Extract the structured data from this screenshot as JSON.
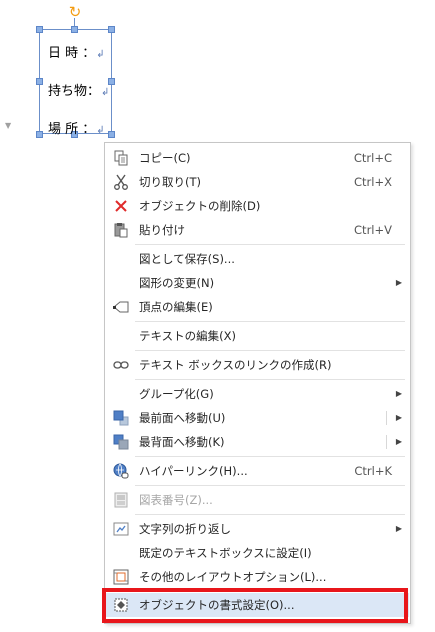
{
  "textbox": {
    "lines": [
      "日 時 ：",
      "持ち物：",
      "場 所 ："
    ],
    "para_mark": "↲"
  },
  "menu": {
    "items": [
      {
        "icon": "copy-icon",
        "label": "コピー(C)",
        "shortcut": "Ctrl+C"
      },
      {
        "icon": "scissors-icon",
        "label": "切り取り(T)",
        "shortcut": "Ctrl+X"
      },
      {
        "icon": "delete-x-icon",
        "label": "オブジェクトの削除(D)",
        "shortcut": ""
      },
      {
        "icon": "paste-icon",
        "label": "貼り付け",
        "shortcut": "Ctrl+V"
      },
      {
        "icon": "",
        "label": "図として保存(S)...",
        "shortcut": ""
      },
      {
        "icon": "",
        "label": "図形の変更(N)",
        "shortcut": "",
        "submenu": true
      },
      {
        "icon": "edit-points-icon",
        "label": "頂点の編集(E)",
        "shortcut": ""
      },
      {
        "icon": "",
        "label": "テキストの編集(X)",
        "shortcut": ""
      },
      {
        "icon": "link-icon",
        "label": "テキスト ボックスのリンクの作成(R)",
        "shortcut": ""
      },
      {
        "icon": "",
        "label": "グループ化(G)",
        "shortcut": "",
        "submenu": true
      },
      {
        "icon": "bring-front-icon",
        "label": "最前面へ移動(U)",
        "shortcut": "",
        "submenu": true,
        "split": true
      },
      {
        "icon": "send-back-icon",
        "label": "最背面へ移動(K)",
        "shortcut": "",
        "submenu": true,
        "split": true
      },
      {
        "icon": "hyperlink-icon",
        "label": "ハイパーリンク(H)...",
        "shortcut": "Ctrl+K"
      },
      {
        "icon": "caption-icon",
        "label": "図表番号(Z)...",
        "shortcut": "",
        "disabled": true
      },
      {
        "icon": "wrap-text-icon",
        "label": "文字列の折り返し",
        "shortcut": "",
        "submenu": true
      },
      {
        "icon": "",
        "label": "既定のテキストボックスに設定(I)",
        "shortcut": ""
      },
      {
        "icon": "layout-options-icon",
        "label": "その他のレイアウトオプション(L)...",
        "shortcut": ""
      },
      {
        "icon": "format-object-icon",
        "label": "オブジェクトの書式設定(O)...",
        "shortcut": "",
        "highlighted": true
      }
    ]
  },
  "colors": {
    "highlight_frame": "#e8161b",
    "selection_handle": "#8bb0e5",
    "rotate_handle": "#f39c12",
    "menu_hover": "#dbe7f6"
  }
}
